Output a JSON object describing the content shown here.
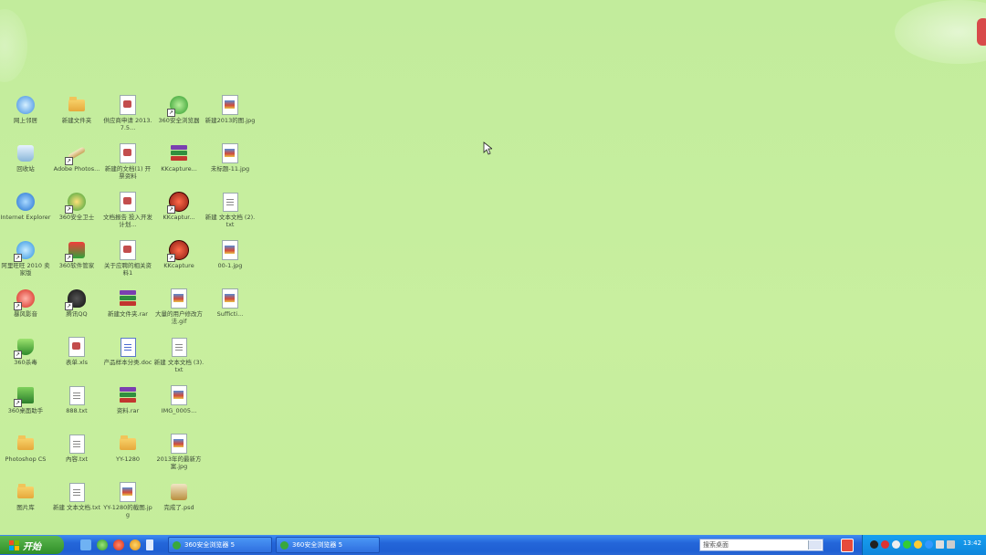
{
  "desktop": {
    "background_color": "#c6ee9d",
    "icons": [
      {
        "label": "网上邻居",
        "icon": "network-icon",
        "shortcut": false
      },
      {
        "label": "新建文件夹",
        "icon": "folder-icon",
        "shortcut": false
      },
      {
        "label": "供应商申请 2013.7.5...",
        "icon": "wps-doc-icon",
        "shortcut": false
      },
      {
        "label": "360安全浏览器",
        "icon": "browser-360-icon",
        "shortcut": true
      },
      {
        "label": "新建2013的图.jpg",
        "icon": "image-icon",
        "shortcut": false
      },
      {
        "label": "回收站",
        "icon": "recycle-bin-icon",
        "shortcut": false
      },
      {
        "label": "Adobe Photos...",
        "icon": "photoshop-icon",
        "shortcut": true
      },
      {
        "label": "新建的文档(1) 开票资料",
        "icon": "wps-doc-icon",
        "shortcut": false
      },
      {
        "label": "KKcapture...",
        "icon": "rar-icon",
        "shortcut": false
      },
      {
        "label": "未标题-11.jpg",
        "icon": "image-icon",
        "shortcut": false
      },
      {
        "label": "Internet Explorer",
        "icon": "ie-icon",
        "shortcut": false
      },
      {
        "label": "360安全卫士",
        "icon": "guard-360-icon",
        "shortcut": true
      },
      {
        "label": "文档报告 投入开发计划...",
        "icon": "wps-doc-icon",
        "shortcut": false
      },
      {
        "label": "KKcaptur...",
        "icon": "kk-icon",
        "shortcut": true
      },
      {
        "label": "新建 文本文档 (2).txt",
        "icon": "text-file-icon",
        "shortcut": false
      },
      {
        "label": "阿里旺旺 2010 卖家版",
        "icon": "aliwangwang-icon",
        "shortcut": true
      },
      {
        "label": "360软件管家",
        "icon": "softmgr-360-icon",
        "shortcut": true
      },
      {
        "label": "关于应聘的相关资料1",
        "icon": "wps-doc-icon",
        "shortcut": false
      },
      {
        "label": "KKcapture",
        "icon": "kk-icon",
        "shortcut": true
      },
      {
        "label": "00-1.jpg",
        "icon": "image-icon",
        "shortcut": false
      },
      {
        "label": "暴风影音",
        "icon": "storm-icon",
        "shortcut": true
      },
      {
        "label": "腾讯QQ",
        "icon": "qq-icon",
        "shortcut": true
      },
      {
        "label": "新建文件夹.rar",
        "icon": "rar-icon",
        "shortcut": false
      },
      {
        "label": "大量的用户修改方法.gif",
        "icon": "gif-icon",
        "shortcut": false
      },
      {
        "label": "Sufficti...",
        "icon": "image-icon",
        "shortcut": false
      },
      {
        "label": "360杀毒",
        "icon": "antivirus-360-icon",
        "shortcut": true
      },
      {
        "label": "表单.xls",
        "icon": "wps-doc-icon",
        "shortcut": false
      },
      {
        "label": "产品样本分类.doc",
        "icon": "word-doc-icon",
        "shortcut": false
      },
      {
        "label": "新建 文本文档 (3).txt",
        "icon": "text-file-icon",
        "shortcut": false
      },
      {
        "label": "",
        "icon": "",
        "shortcut": false
      },
      {
        "label": "360桌面助手",
        "icon": "desktop-360-icon",
        "shortcut": true
      },
      {
        "label": "888.txt",
        "icon": "text-file-icon",
        "shortcut": false
      },
      {
        "label": "资料.rar",
        "icon": "rar-icon",
        "shortcut": false
      },
      {
        "label": "IMG_0005...",
        "icon": "image-icon",
        "shortcut": false
      },
      {
        "label": "",
        "icon": "",
        "shortcut": false
      },
      {
        "label": "Photoshop CS",
        "icon": "folder-icon",
        "shortcut": false
      },
      {
        "label": "內容.txt",
        "icon": "text-file-icon",
        "shortcut": false
      },
      {
        "label": "YY-1280",
        "icon": "folder-icon",
        "shortcut": false
      },
      {
        "label": "2013年的最新方案.jpg",
        "icon": "image-icon",
        "shortcut": false
      },
      {
        "label": "",
        "icon": "",
        "shortcut": false
      },
      {
        "label": "图片库",
        "icon": "folder-icon",
        "shortcut": false
      },
      {
        "label": "新建 文本文档.txt",
        "icon": "text-file-icon",
        "shortcut": false
      },
      {
        "label": "YY-1280的截图.jpg",
        "icon": "image-icon",
        "shortcut": false
      },
      {
        "label": "完成了.psd",
        "icon": "psd-icon",
        "shortcut": false
      },
      {
        "label": "",
        "icon": "",
        "shortcut": false
      }
    ]
  },
  "taskbar": {
    "start_label": "开始",
    "quick_launch": [
      "show-desktop-icon",
      "browser-360-icon",
      "aliwangwang-icon",
      "storm-icon"
    ],
    "tasks": [
      {
        "label": "360安全浏览器 5"
      },
      {
        "label": "360安全浏览器 5"
      }
    ],
    "search_placeholder": "搜索桌面",
    "clock": "13:42"
  },
  "colors": {
    "taskbar_blue": "#2466d9",
    "start_green": "#3a9a30",
    "tray_blue": "#1395e6"
  }
}
